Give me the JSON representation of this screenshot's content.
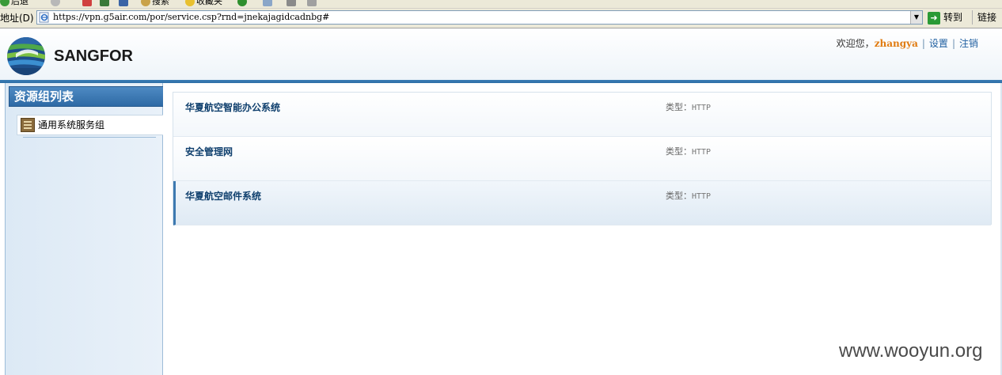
{
  "browser": {
    "toolbar": {
      "back_label": "后退",
      "search_label": "搜索",
      "favorites_label": "收藏夹"
    },
    "address": {
      "label": "地址(D)",
      "url": "https://vpn.g5air.com/por/service.csp?rnd=jnekajagidcadnbg#"
    },
    "go_label": "转到",
    "links_label": "链接"
  },
  "header": {
    "brand": "SANGFOR",
    "welcome": "欢迎您，",
    "username": "zhangya",
    "settings": "设置",
    "logout": "注销",
    "separator": "|"
  },
  "sidebar": {
    "title": "资源组列表",
    "items": [
      {
        "label": "通用系统服务组"
      }
    ]
  },
  "resources": [
    {
      "name": "华夏航空智能办公系统",
      "type_label": "类型：",
      "type_value": "HTTP"
    },
    {
      "name": "安全管理网",
      "type_label": "类型：",
      "type_value": "HTTP"
    },
    {
      "name": "华夏航空邮件系统",
      "type_label": "类型：",
      "type_value": "HTTP"
    }
  ],
  "watermark": "www.wooyun.org",
  "colors": {
    "accent": "#2e6aa5",
    "username": "#e07b10",
    "resource_title": "#10406e"
  }
}
